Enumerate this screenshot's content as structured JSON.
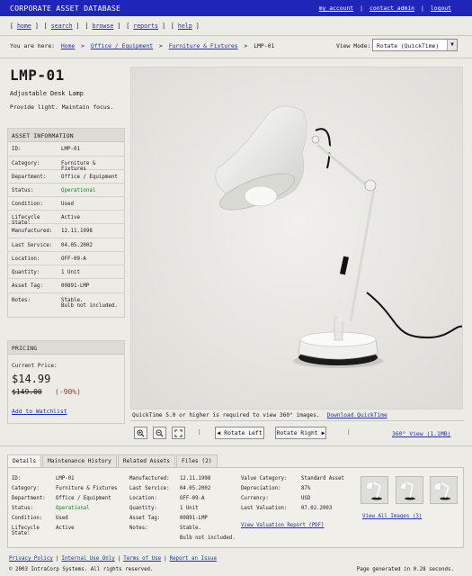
{
  "app": {
    "title": "CORPORATE ASSET DATABASE",
    "account_links": [
      "my_account",
      "contact_admin",
      "logout"
    ],
    "sep": "|"
  },
  "nav": [
    "[ home ]",
    "[ search ]",
    "[ browse ]",
    "[ reports ]",
    "[ help ]"
  ],
  "nav_labels": [
    "home",
    "search",
    "browse",
    "reports",
    "help"
  ],
  "breadcrumb": {
    "prefix": "You are here:",
    "items": [
      "Home",
      "Office / Equipment",
      "Furniture & Fixtures"
    ],
    "current": "LMP-01",
    "sep": ">"
  },
  "view_mode": {
    "label": "View Mode:",
    "value": "Rotate (QuickTime)"
  },
  "asset": {
    "id_title": "LMP-01",
    "name": "Adjustable Desk Lamp",
    "description": "Provide light. Maintain focus."
  },
  "info_panel": {
    "heading": "ASSET INFORMATION",
    "rows": [
      {
        "k": "ID:",
        "v": "LMP-01"
      },
      {
        "k": "Category:",
        "v": "Furniture & Fixtures"
      },
      {
        "k": "Department:",
        "v": "Office / Equipment"
      },
      {
        "k": "Status:",
        "v": "Operational"
      },
      {
        "k": "Condition:",
        "v": "Used"
      },
      {
        "k": "Lifecycle State:",
        "v": "Active"
      },
      {
        "k": "Manufactured:",
        "v": "12.11.1998"
      },
      {
        "k": "Last Service:",
        "v": "04.05.2002"
      },
      {
        "k": "Location:",
        "v": "OFF-09-A"
      },
      {
        "k": "Quantity:",
        "v": "1 Unit"
      },
      {
        "k": "Asset Tag:",
        "v": "00891-LMP"
      },
      {
        "k": "Notes:",
        "v": "Stable.",
        "v2": "Bulb not included."
      }
    ]
  },
  "pricing": {
    "heading": "PRICING",
    "label": "Current Price:",
    "price": "$14.99",
    "old_price": "$149.00",
    "discount": "(-90%)",
    "watchlist": "Add to Watchlist"
  },
  "viewer": {
    "notice": "QuickTime 5.0 or higher is required to view 360° images.",
    "download": "Download QuickTime",
    "rotate_left": "Rotate Left",
    "rotate_right": "Rotate Right",
    "view360": "360° View (1.1MB)",
    "sep": "|"
  },
  "tabs": [
    "Details",
    "Maintenance History",
    "Related Assets",
    "Files (2)"
  ],
  "details": {
    "col1": [
      {
        "k": "ID:",
        "v": "LMP-01"
      },
      {
        "k": "Category:",
        "v": "Furniture & Fixtures"
      },
      {
        "k": "Department:",
        "v": "Office / Equipment"
      },
      {
        "k": "Status:",
        "v": "Operational"
      },
      {
        "k": "Condition:",
        "v": "Used"
      },
      {
        "k": "Lifecycle State:",
        "v": "Active"
      }
    ],
    "col2": [
      {
        "k": "Manufactured:",
        "v": "12.11.1998"
      },
      {
        "k": "Last Service:",
        "v": "04.05.2002"
      },
      {
        "k": "Location:",
        "v": "OFF-09-A"
      },
      {
        "k": "Quantity:",
        "v": "1 Unit"
      },
      {
        "k": "Asset Tag:",
        "v": "00891-LMP"
      },
      {
        "k": "Notes:",
        "v": "Stable."
      },
      {
        "k": "",
        "v": "Bulb not included."
      }
    ],
    "col3": [
      {
        "k": "Value Category:",
        "v": "Standard Asset"
      },
      {
        "k": "Depreciation:",
        "v": "87%"
      },
      {
        "k": "Currency:",
        "v": "USD"
      },
      {
        "k": "Last Valuation:",
        "v": "07.02.2003"
      }
    ],
    "valuation_link": "View Valuation Report (PDF)",
    "view_all": "View All Images (3)"
  },
  "footer": {
    "links": [
      "Privacy Policy",
      "Internal Use Only",
      "Terms of Use",
      "Report an Issue"
    ],
    "sep": "|",
    "copyright": "© 2003 IntraCorp Systems. All rights reserved.",
    "generated": "Page generated in 0.28 seconds."
  },
  "colors": {
    "topbar": "#1e25b8",
    "link": "#1f2fb0",
    "status_ok": "#1c7a2a",
    "discount": "#a23a2a"
  }
}
